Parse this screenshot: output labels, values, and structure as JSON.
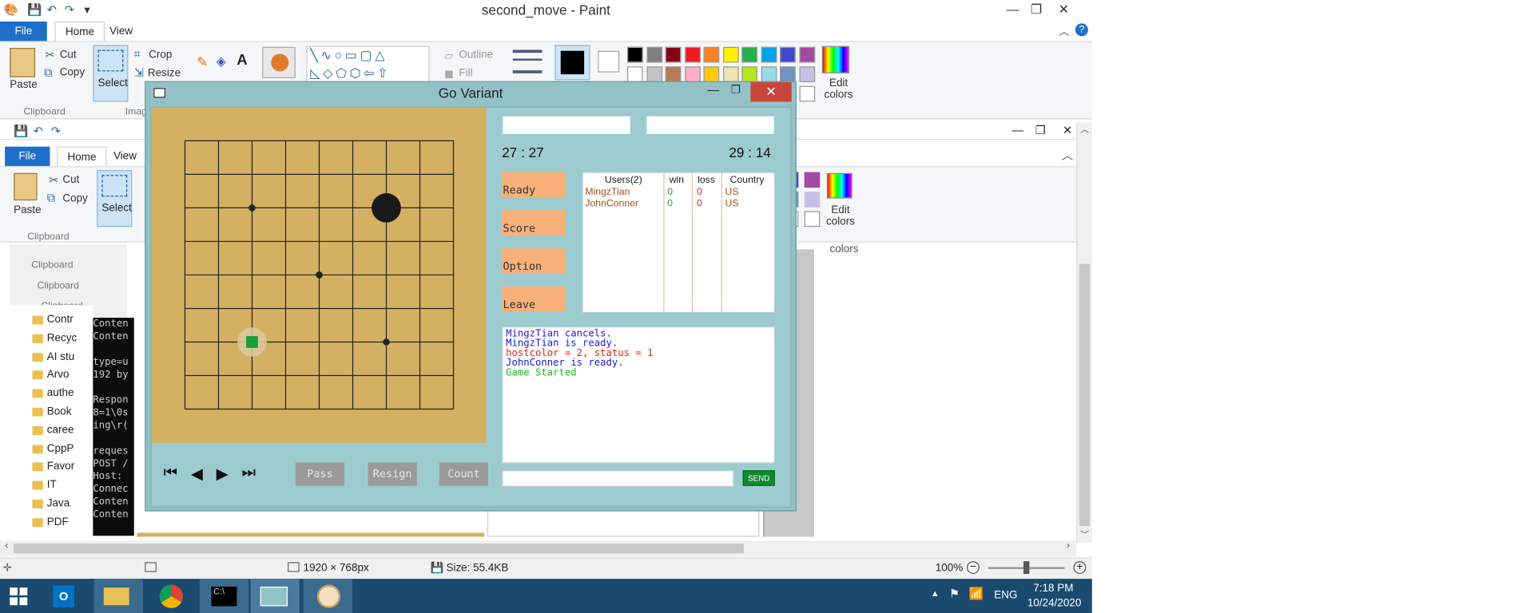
{
  "paint": {
    "title": "second_move - Paint",
    "tabs": [
      "File",
      "Home",
      "View"
    ],
    "clipboard": {
      "paste": "Paste",
      "cut": "Cut",
      "copy": "Copy",
      "group": "Clipboard"
    },
    "image": {
      "select": "Select",
      "crop": "Crop",
      "resize": "Resize",
      "group": "Imag"
    },
    "shapes": {
      "outline": "Outline",
      "fill": "Fill"
    },
    "edit_colors": "Edit colors",
    "colors_label": "colors",
    "palette_top": [
      "#000000",
      "#7f7f7f",
      "#880015",
      "#ed1c24",
      "#ff7f27",
      "#fff200",
      "#22b14c",
      "#00a2e8",
      "#3f48cc",
      "#a349a4"
    ],
    "palette_bottom": [
      "#ffffff",
      "#c3c3c3",
      "#b97a57",
      "#ffaec9",
      "#ffc90e",
      "#efe4b0",
      "#b5e61d",
      "#99d9ea",
      "#7092be",
      "#c8bfe7"
    ],
    "status": {
      "dimensions": "1920 × 768px",
      "size": "Size: 55.4KB",
      "zoom": "100%"
    }
  },
  "explorer": {
    "items": [
      "Contr",
      "Recyc",
      "AI stu",
      "Arvo",
      "authe",
      "Book",
      "caree",
      "CppP",
      "Favor",
      "IT",
      "Java",
      "PDF"
    ]
  },
  "console": {
    "lines": [
      "Conten",
      "Conten",
      "",
      "type=u",
      "192 by",
      "",
      "Respon",
      "8=1\\0s",
      "ing\\r(",
      "",
      "reques",
      "POST /",
      "Host: ",
      "Connec",
      "Conten",
      "Conten"
    ]
  },
  "go": {
    "title": "Go Variant",
    "timer_left": "27 : 27",
    "timer_right": "29 : 14",
    "buttons": [
      "Ready",
      "Score",
      "Option",
      "Leave"
    ],
    "game_buttons": [
      "Pass",
      "Resign",
      "Count"
    ],
    "send": "SEND",
    "table": {
      "headers": [
        "Users(2)",
        "win",
        "loss",
        "Country"
      ],
      "rows": [
        {
          "user": "MingzTian",
          "win": "0",
          "loss": "0",
          "country": "US"
        },
        {
          "user": "JohnConner",
          "win": "0",
          "loss": "0",
          "country": "US"
        }
      ]
    },
    "log": [
      {
        "text": "MingzTian cancels.",
        "color": "#1a1ad6"
      },
      {
        "text": "MingzTian is ready.",
        "color": "#1a1ad6"
      },
      {
        "text": "hostcolor = 2, status = 1",
        "color": "#e0201a"
      },
      {
        "text": "JohnConner is ready.",
        "color": "#1a1ad6"
      },
      {
        "text": "Game Started",
        "color": "#1fb81f"
      }
    ],
    "board": {
      "size": 9,
      "black_stone": [
        6,
        2
      ],
      "last_move_marker": [
        2,
        6
      ],
      "star_points": [
        [
          2,
          2
        ],
        [
          4,
          4
        ],
        [
          6,
          6
        ]
      ]
    }
  },
  "taskbar": {
    "lang": "ENG",
    "time": "7:18 PM",
    "date": "10/24/2020"
  }
}
